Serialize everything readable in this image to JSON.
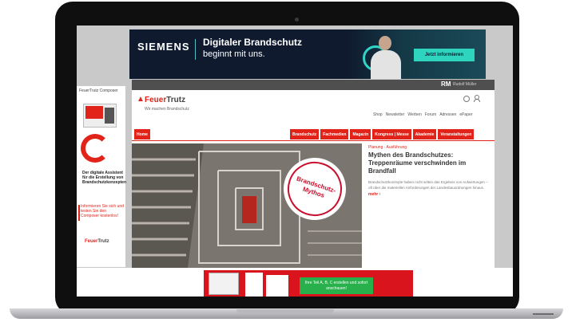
{
  "top_ad": {
    "logo": "SIEMENS",
    "title": "Digitaler Brandschutz",
    "subtitle": "beginnt mit uns.",
    "cta": "Jetzt informieren"
  },
  "userbar": {
    "initials": "RM",
    "username": "Rudolf Müller"
  },
  "site": {
    "brand_main": "Feuer",
    "brand_sub": "Trutz",
    "tagline": "Wir machen Brandschutz",
    "utility_links": [
      "Shop",
      "Newsletter",
      "Werben",
      "Forum",
      "Adressen",
      "ePaper"
    ],
    "nav_home": "Home",
    "nav_items": [
      "Brandschutz",
      "Fachmedien",
      "Magazin",
      "Kongress | Messe",
      "Akademie",
      "Veranstaltungen"
    ]
  },
  "hero": {
    "stamp_line1": "Brandschutz-",
    "stamp_line2": "Mythos"
  },
  "article": {
    "kicker": "Planung · Ausführung",
    "title": "Mythen des Brandschutzes: Treppenräume verschwinden im Brandfall",
    "body": "Brandschutzkonzepte haben nicht selten das Ergebnis von Aufwertungen – oft über die materiellen Anforderungen der Landesbauordnungen hinaus.",
    "more": "mehr ›"
  },
  "side_ad": {
    "head": "FeuerTrutz Composer",
    "desc": "Der digitale Assistent für die Erstellung von Brandschutzkonzepten",
    "cta": "Informieren Sie sich und testen Sie den Composer kostenlos!",
    "logo_main": "Feuer",
    "logo_sub": "Trutz"
  },
  "bottom_ad": {
    "cta": "Ihre Teil A, B, C erstellen und sofort anschauen!"
  },
  "colors": {
    "brand_red": "#e2231a",
    "siemens_teal": "#2fd4bf",
    "cta_green": "#27b04b"
  }
}
